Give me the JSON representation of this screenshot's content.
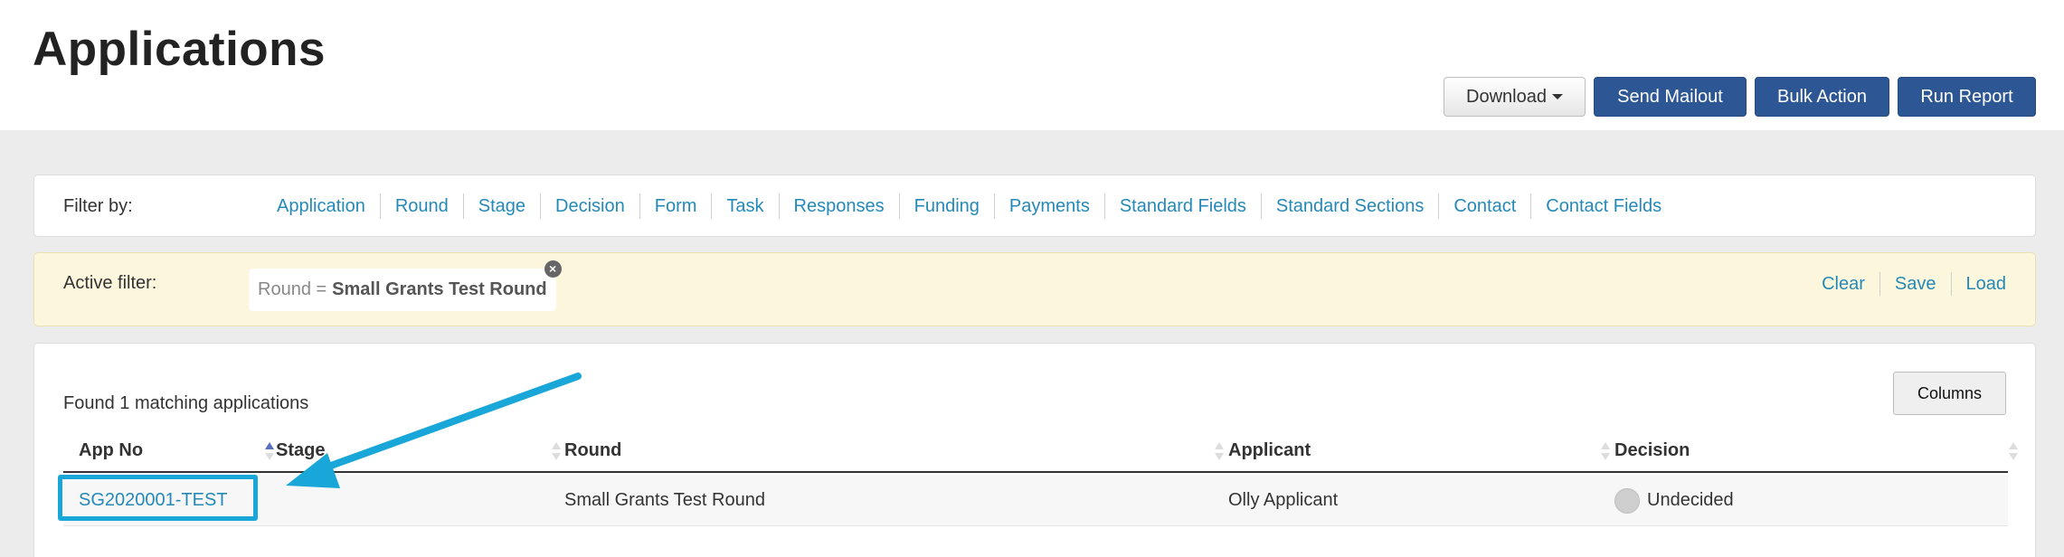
{
  "page": {
    "title": "Applications"
  },
  "toolbar": {
    "download_label": "Download",
    "send_mailout_label": "Send Mailout",
    "bulk_action_label": "Bulk Action",
    "run_report_label": "Run Report"
  },
  "filter": {
    "label": "Filter by:",
    "links": [
      "Application",
      "Round",
      "Stage",
      "Decision",
      "Form",
      "Task",
      "Responses",
      "Funding",
      "Payments",
      "Standard Fields",
      "Standard Sections",
      "Contact",
      "Contact Fields"
    ]
  },
  "active_filter": {
    "label": "Active filter:",
    "chip_key": "Round =",
    "chip_value": "Small Grants Test Round",
    "actions": [
      "Clear",
      "Save",
      "Load"
    ]
  },
  "results": {
    "found_text": "Found 1 matching applications",
    "columns_label": "Columns",
    "headers": [
      "App No",
      "Stage",
      "Round",
      "Applicant",
      "Decision"
    ],
    "rows": [
      {
        "app_no": "SG2020001-TEST",
        "stage": "",
        "round": "Small Grants Test Round",
        "applicant": "Olly Applicant",
        "decision": "Undecided"
      }
    ]
  },
  "colors": {
    "primary_button": "#2c5694",
    "link": "#2589b8",
    "annotation": "#18a7d8",
    "active_filter_bg": "#fcf6dc"
  },
  "icons": [
    "caret-down-icon",
    "close-circle-icon",
    "sort-icon",
    "status-dot-icon",
    "arrow-annotation"
  ]
}
